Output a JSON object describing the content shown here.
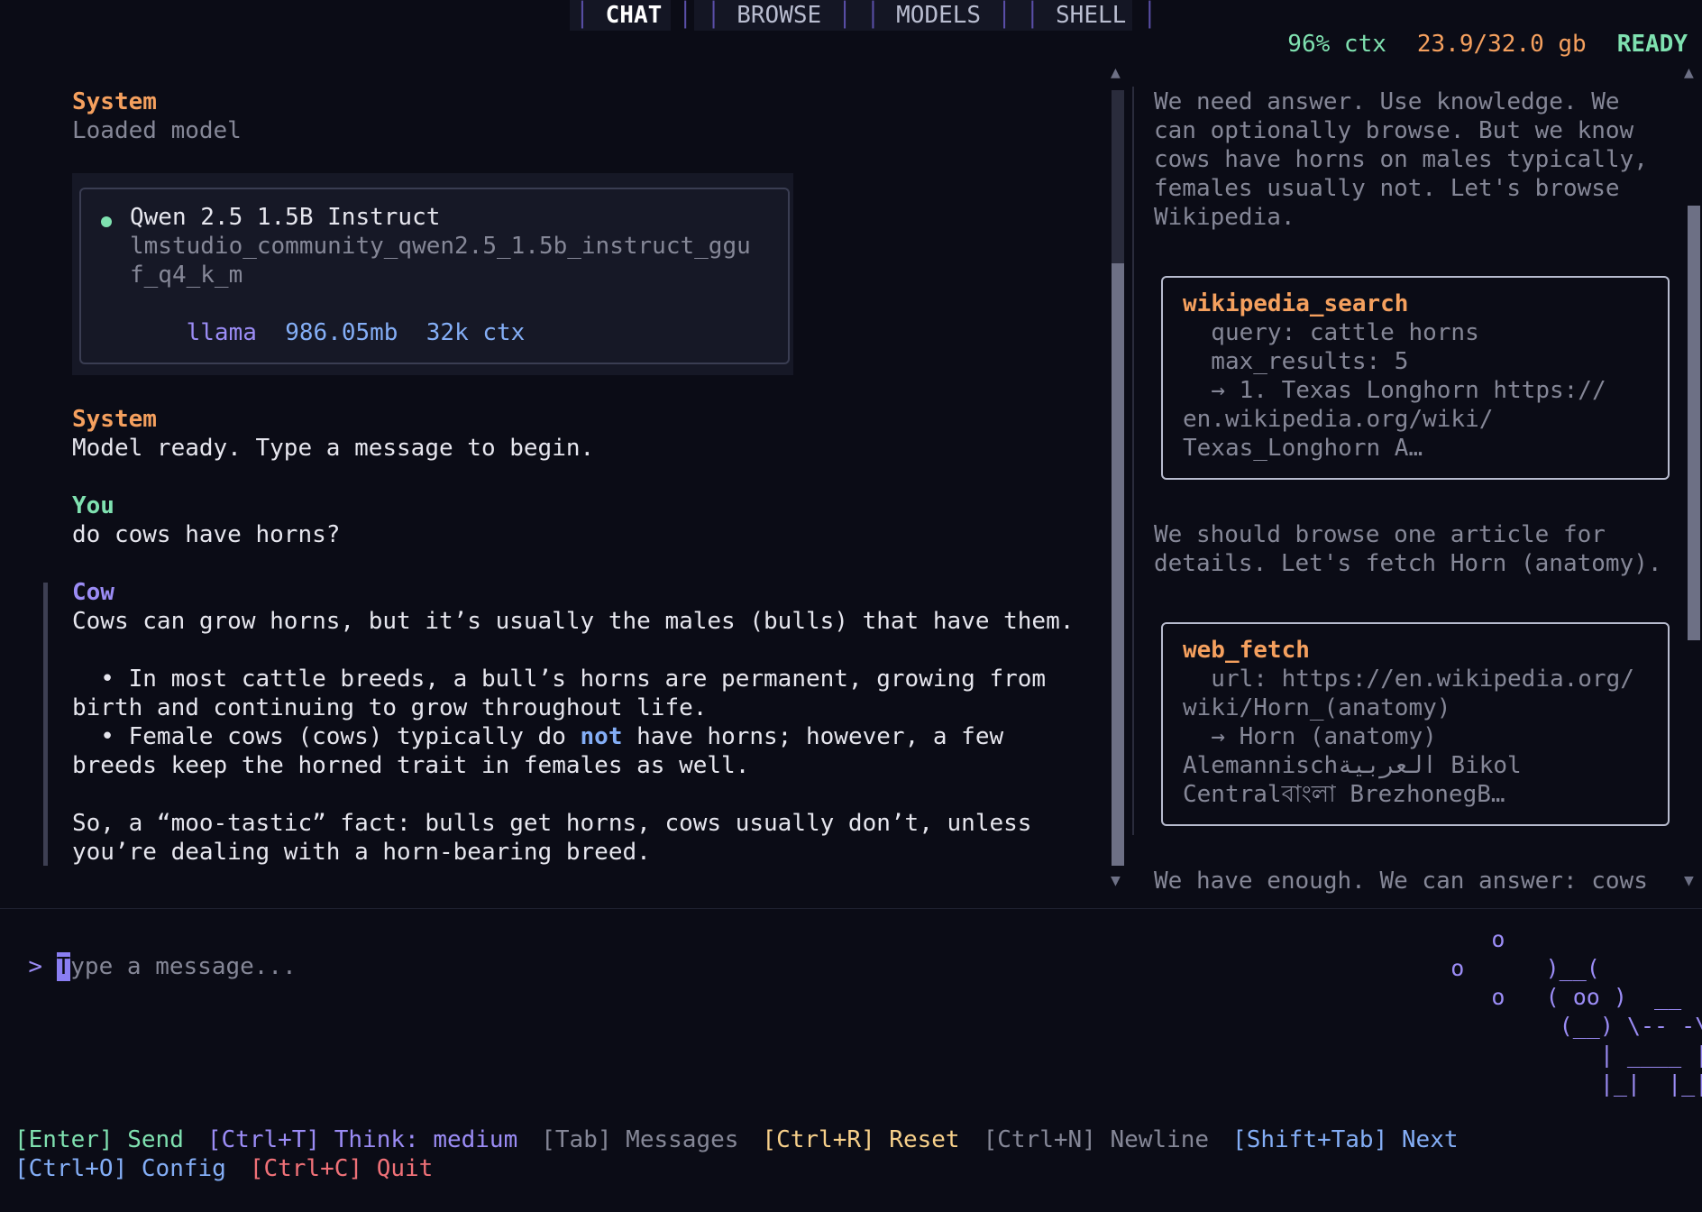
{
  "tabs": [
    {
      "label": "CHAT",
      "active": true
    },
    {
      "label": "BROWSE",
      "active": false
    },
    {
      "label": "MODELS",
      "active": false
    },
    {
      "label": "SHELL",
      "active": false
    }
  ],
  "status": {
    "ctx": "96% ctx",
    "memory": "23.9/32.0 gb",
    "state": "READY"
  },
  "chat": {
    "system1": {
      "role": "System",
      "text": "Loaded model"
    },
    "model_card": {
      "name": "Qwen 2.5 1.5B Instruct",
      "id_line1": "lmstudio_community_qwen2.5_1.5b_instruct_ggu",
      "id_line2": "f_q4_k_m",
      "arch": "llama",
      "size": "986.05mb",
      "ctx": "32k ctx"
    },
    "system2": {
      "role": "System",
      "text": "Model ready. Type a message to begin."
    },
    "user": {
      "role": "You",
      "text": "do cows have horns?"
    },
    "assistant": {
      "role": "Cow",
      "line1": "Cows can grow horns, but it’s usually the males (bulls) that have them.",
      "bullet1_line1": "  • In most cattle breeds, a bull’s horns are permanent, growing from",
      "bullet1_line2": "birth and continuing to grow throughout life.",
      "bullet2_pre": "  • Female cows (cows) typically do ",
      "bullet2_emph": "not",
      "bullet2_post": " have horns; however, a few",
      "bullet2_line2": "breeds keep the horned trait in females as well.",
      "closing_line1": "So, a “moo-tastic” fact: bulls get horns, cows usually don’t, unless",
      "closing_line2": "you’re dealing with a horn-bearing breed."
    }
  },
  "reasoning": {
    "para1": [
      "We need answer. Use knowledge. We",
      "can optionally browse. But we know",
      "cows have horns on males typically,",
      "females usually not. Let's browse",
      "Wikipedia."
    ],
    "tool1": {
      "name": "wikipedia_search",
      "lines": [
        "  query: cattle horns",
        "  max_results: 5",
        "  → 1. Texas Longhorn https://",
        "en.wikipedia.org/wiki/",
        "Texas_Longhorn A…"
      ]
    },
    "para2": [
      "We should browse one article for",
      "details. Let's fetch Horn (anatomy)."
    ],
    "tool2": {
      "name": "web_fetch",
      "lines": [
        "  url: https://en.wikipedia.org/",
        "wiki/Horn_(anatomy)",
        "  → Horn (anatomy)",
        "Alemannischالعربية Bikol",
        "Centralবাংলা BrezhonegB…"
      ]
    },
    "para3": "We have enough. We can answer: cows"
  },
  "input": {
    "prompt_symbol": ">",
    "placeholder_first": "T",
    "placeholder_rest": "ype a message..."
  },
  "cow_art": {
    "l1": "        o",
    "l2": "     o      )__(",
    "l3": "        o   ( oo )  __",
    "l4": "             (__) \\-- -\\",
    "l5": "                | ____ | |",
    "l6": "                |_|  |_| *"
  },
  "footer": {
    "row1": [
      {
        "key": "[Enter]",
        "action": "Send",
        "color": "#7fe1b0",
        "key_color": "#7fe1b0"
      },
      {
        "key": "[Ctrl+T]",
        "action": "Think: medium",
        "color": "#9b8cf5",
        "key_color": "#9b8cf5"
      },
      {
        "key": "[Tab]",
        "action": "Messages",
        "color": "#858797",
        "key_color": "#858797"
      },
      {
        "key": "[Ctrl+R]",
        "action": "Reset",
        "color": "#f7d08a",
        "key_color": "#f7d08a"
      },
      {
        "key": "[Ctrl+N]",
        "action": "Newline",
        "color": "#858797",
        "key_color": "#858797"
      },
      {
        "key": "[Shift+Tab]",
        "action": "Next",
        "color": "#84aef6",
        "key_color": "#84aef6"
      }
    ],
    "row2": [
      {
        "key": "[Ctrl+O]",
        "action": "Config",
        "color": "#84aef6",
        "key_color": "#84aef6"
      },
      {
        "key": "[Ctrl+C]",
        "action": "Quit",
        "color": "#f07178",
        "key_color": "#f07178"
      }
    ]
  }
}
